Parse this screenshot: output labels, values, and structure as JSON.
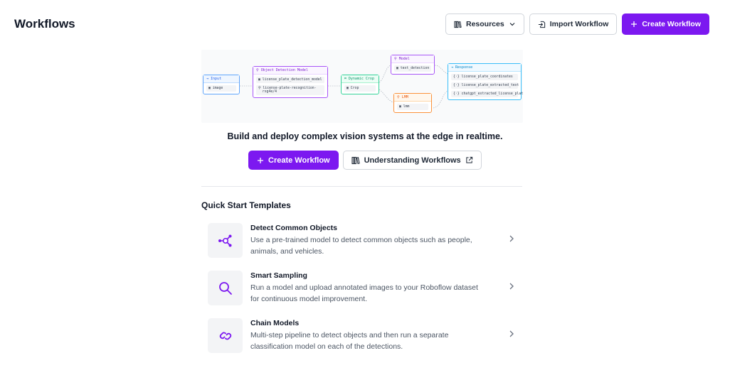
{
  "header": {
    "title": "Workflows",
    "resources_label": "Resources",
    "import_label": "Import Workflow",
    "create_label": "Create Workflow"
  },
  "diagram": {
    "input": {
      "header": "Input",
      "row": "image"
    },
    "object_detection": {
      "header": "Object Detection Model",
      "row1": "license_plate_detection_model",
      "row2a": "license-plate-recognition-",
      "row2b": "rxg4e/4"
    },
    "dynamic_crop": {
      "header": "Dynamic Crop",
      "row": "Crop"
    },
    "model": {
      "header": "Model",
      "row": "text_detection"
    },
    "lmm": {
      "header": "LMM",
      "row": "lmm"
    },
    "response": {
      "header": "Response",
      "row1": "license_plate_coordinates",
      "row2": "license_plate_extracted_text",
      "row3": "chatgpt_extracted_license_plate"
    }
  },
  "hero": {
    "tagline": "Build and deploy complex vision systems at the edge in realtime.",
    "create_label": "Create Workflow",
    "understanding_label": "Understanding Workflows"
  },
  "quick_start": {
    "title": "Quick Start Templates",
    "templates": [
      {
        "name": "Detect Common Objects",
        "desc_line1": "Use a pre-trained model to detect common objects such as people,",
        "desc_line2": "animals, and vehicles.",
        "icon": "nodes-icon"
      },
      {
        "name": "Smart Sampling",
        "desc_line1": "Run a model and upload annotated images to your Roboflow dataset",
        "desc_line2": "for continuous model improvement.",
        "icon": "search-icon"
      },
      {
        "name": "Chain Models",
        "desc_line1": "Multi-step pipeline to detect objects and then run a separate",
        "desc_line2": "classification model on each of the detections.",
        "icon": "link-icon"
      }
    ]
  },
  "colors": {
    "primary": "#7c18f0",
    "border": "#d1d5db",
    "muted_text": "#4b5563"
  }
}
